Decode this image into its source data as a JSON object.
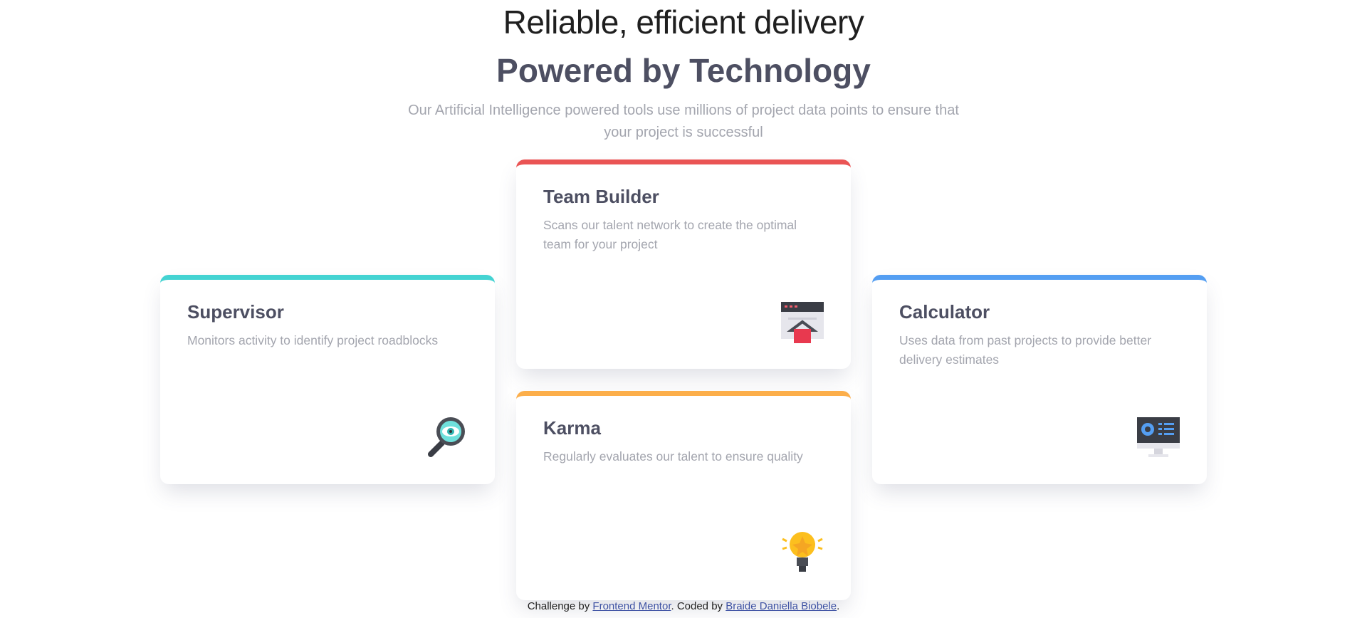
{
  "header": {
    "tagline": "Reliable, efficient delivery",
    "title": "Powered by Technology",
    "subtitle": "Our Artificial Intelligence powered tools use millions of project data points to ensure that your project is successful"
  },
  "cards": [
    {
      "title": "Supervisor",
      "description": "Monitors activity to identify project roadblocks",
      "icon": "magnifier-eye-icon",
      "accent": "#44d3d2"
    },
    {
      "title": "Team Builder",
      "description": "Scans our talent network to create the optimal team for your project",
      "icon": "browser-house-icon",
      "accent": "#ea5454"
    },
    {
      "title": "Karma",
      "description": "Regularly evaluates our talent to ensure quality",
      "icon": "lightbulb-icon",
      "accent": "#fcae4a"
    },
    {
      "title": "Calculator",
      "description": "Uses data from past projects to provide better delivery estimates",
      "icon": "monitor-chart-icon",
      "accent": "#549ef2"
    }
  ],
  "footer": {
    "prefix": "Challenge by ",
    "link1": "Frontend Mentor",
    "middle": ". Coded by ",
    "link2": "Braide Daniella Biobele",
    "suffix": "."
  }
}
